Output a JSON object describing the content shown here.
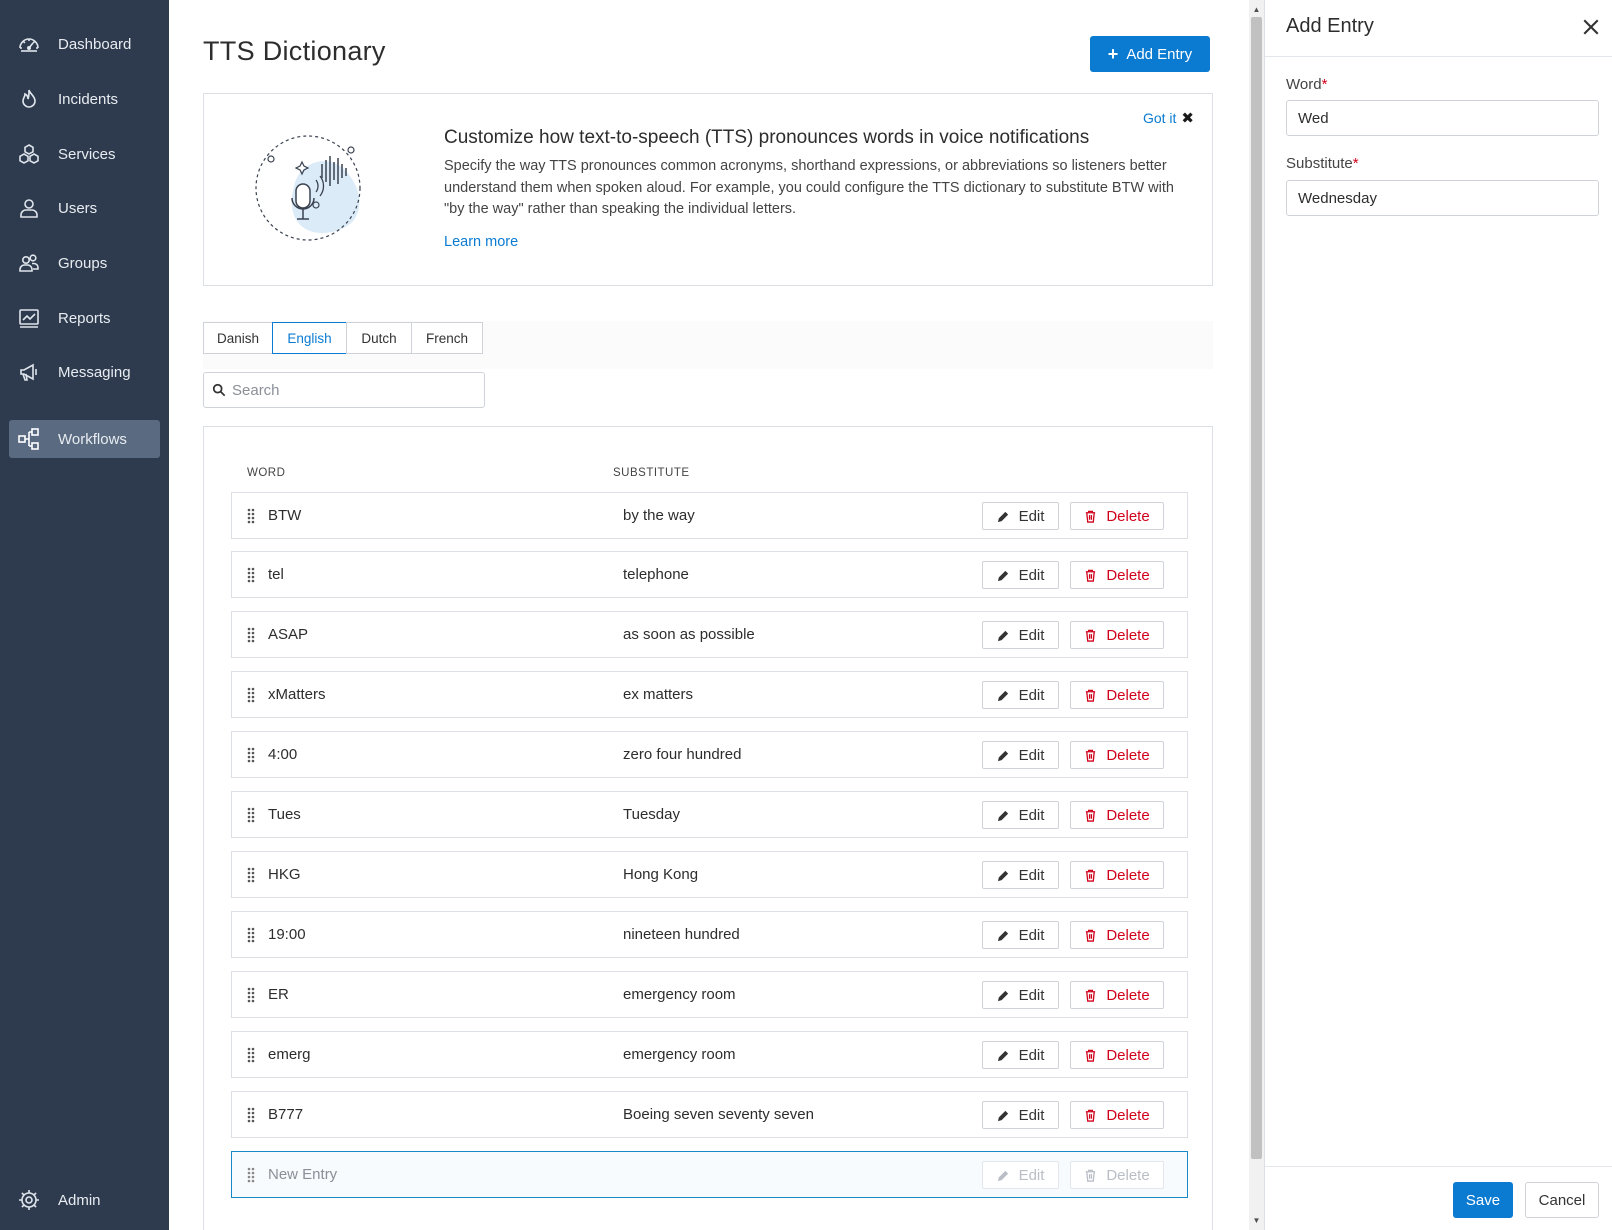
{
  "sidebar": {
    "items": [
      {
        "label": "Dashboard",
        "icon": "dashboard-icon"
      },
      {
        "label": "Incidents",
        "icon": "flame-icon"
      },
      {
        "label": "Services",
        "icon": "services-icon"
      },
      {
        "label": "Users",
        "icon": "user-icon"
      },
      {
        "label": "Groups",
        "icon": "groups-icon"
      },
      {
        "label": "Reports",
        "icon": "reports-icon"
      },
      {
        "label": "Messaging",
        "icon": "megaphone-icon"
      },
      {
        "label": "Workflows",
        "icon": "workflow-icon",
        "active": true
      }
    ],
    "admin_label": "Admin",
    "collapse_glyph": "«"
  },
  "header": {
    "title": "TTS Dictionary",
    "add_entry_label": "Add Entry"
  },
  "info_card": {
    "heading": "Customize how text-to-speech (TTS) pronounces words in voice notifications",
    "body": "Specify the way TTS pronounces common acronyms, shorthand expressions, or abbreviations so listeners better understand them when spoken aloud. For example, you could configure the TTS dictionary to substitute BTW with \"by the way\" rather than speaking the individual letters.",
    "learn_more": "Learn more",
    "got_it": "Got it"
  },
  "tabs": [
    {
      "label": "Danish"
    },
    {
      "label": "English",
      "active": true
    },
    {
      "label": "Dutch"
    },
    {
      "label": "French"
    }
  ],
  "search": {
    "placeholder": "Search",
    "value": ""
  },
  "table": {
    "columns": [
      "WORD",
      "SUBSTITUTE"
    ],
    "edit_label": "Edit",
    "delete_label": "Delete",
    "rows": [
      {
        "word": "BTW",
        "substitute": "by the way"
      },
      {
        "word": "tel",
        "substitute": "telephone"
      },
      {
        "word": "ASAP",
        "substitute": "as soon as possible"
      },
      {
        "word": "xMatters",
        "substitute": "ex matters"
      },
      {
        "word": "4:00",
        "substitute": "zero four hundred"
      },
      {
        "word": "Tues",
        "substitute": "Tuesday"
      },
      {
        "word": "HKG",
        "substitute": "Hong Kong"
      },
      {
        "word": "19:00",
        "substitute": "nineteen hundred"
      },
      {
        "word": "ER",
        "substitute": "emergency room"
      },
      {
        "word": "emerg",
        "substitute": "emergency room"
      },
      {
        "word": "B777",
        "substitute": "Boeing seven seventy seven"
      }
    ],
    "new_entry_label": "New Entry"
  },
  "panel": {
    "title": "Add Entry",
    "word_label": "Word",
    "word_value": "Wed",
    "substitute_label": "Substitute",
    "substitute_value": "Wednesday",
    "required_mark": "*",
    "save_label": "Save",
    "cancel_label": "Cancel"
  },
  "colors": {
    "sidebar_bg": "#2e3b4e",
    "accent": "#0b7bd2",
    "danger": "#d0021b"
  }
}
